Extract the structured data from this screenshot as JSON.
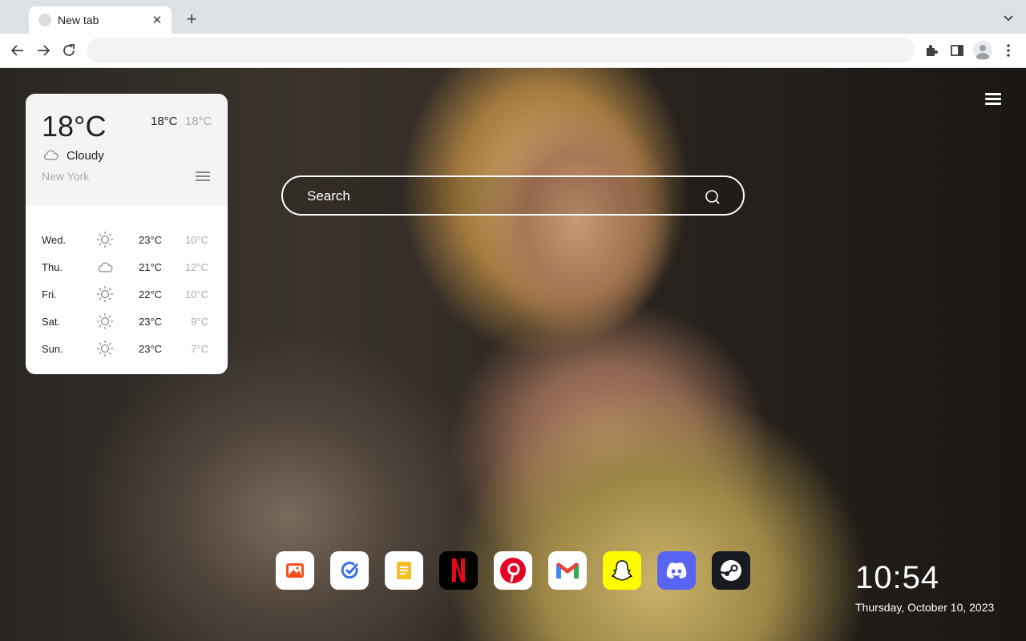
{
  "browser": {
    "tab_title": "New tab",
    "new_tab_symbol": "+",
    "close_symbol": "✕",
    "address_value": ""
  },
  "search": {
    "placeholder": "Search"
  },
  "weather": {
    "current_temp": "18°C",
    "today_high": "18°C",
    "today_low": "18°C",
    "condition": "Cloudy",
    "condition_icon": "cloud-icon",
    "city": "New York",
    "forecast": [
      {
        "day": "Wed.",
        "icon": "sun-icon",
        "high": "23°C",
        "low": "10°C"
      },
      {
        "day": "Thu.",
        "icon": "cloud-icon",
        "high": "21°C",
        "low": "12°C"
      },
      {
        "day": "Fri.",
        "icon": "sun-icon",
        "high": "22°C",
        "low": "10°C"
      },
      {
        "day": "Sat.",
        "icon": "sun-icon",
        "high": "23°C",
        "low": "9°C"
      },
      {
        "day": "Sun.",
        "icon": "sun-icon",
        "high": "23°C",
        "low": "7°C"
      }
    ]
  },
  "dock": {
    "apps": [
      "photos",
      "tasks",
      "notes",
      "netflix",
      "pinterest",
      "gmail",
      "snapchat",
      "discord",
      "steam"
    ]
  },
  "clock": {
    "time": "10:54",
    "date": "Thursday, October 10, 2023"
  },
  "colors": {
    "netflix": "#000000",
    "netflix_accent": "#e50914",
    "pinterest": "#e60023",
    "snapchat": "#fffc00",
    "discord": "#5865f2",
    "steam": "#171a21"
  }
}
